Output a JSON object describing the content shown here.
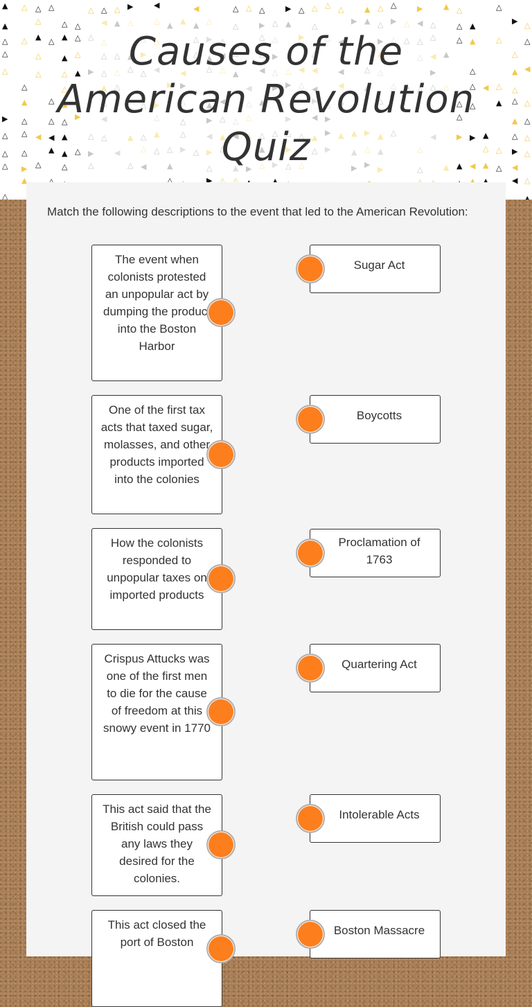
{
  "header": {
    "title_lines": [
      "Causes of the",
      "American Revolution",
      "Quiz"
    ]
  },
  "instructions": "Match the following descriptions to the event that led to the American Revolution:",
  "descriptions": [
    "The event when colonists protested an unpopular act by dumping the product into the Boston Harbor",
    "One of the first tax acts that taxed sugar, molasses, and other products imported into the colonies",
    "How the colonists responded to unpopular taxes on imported products",
    "Crispus Attucks was one of the first men to die for the cause of freedom at this snowy event in 1770",
    "This act said that the British could pass any laws they desired for the colonies.",
    "This act closed the port of Boston"
  ],
  "answers": [
    "Sugar Act",
    "Boycotts",
    "Proclamation of 1763",
    "Quartering Act",
    "Intolerable Acts",
    "Boston Massacre"
  ],
  "colors": {
    "connector_dot": "#fd7e1c",
    "panel_bg": "#f4f4f4",
    "text": "#333333"
  }
}
